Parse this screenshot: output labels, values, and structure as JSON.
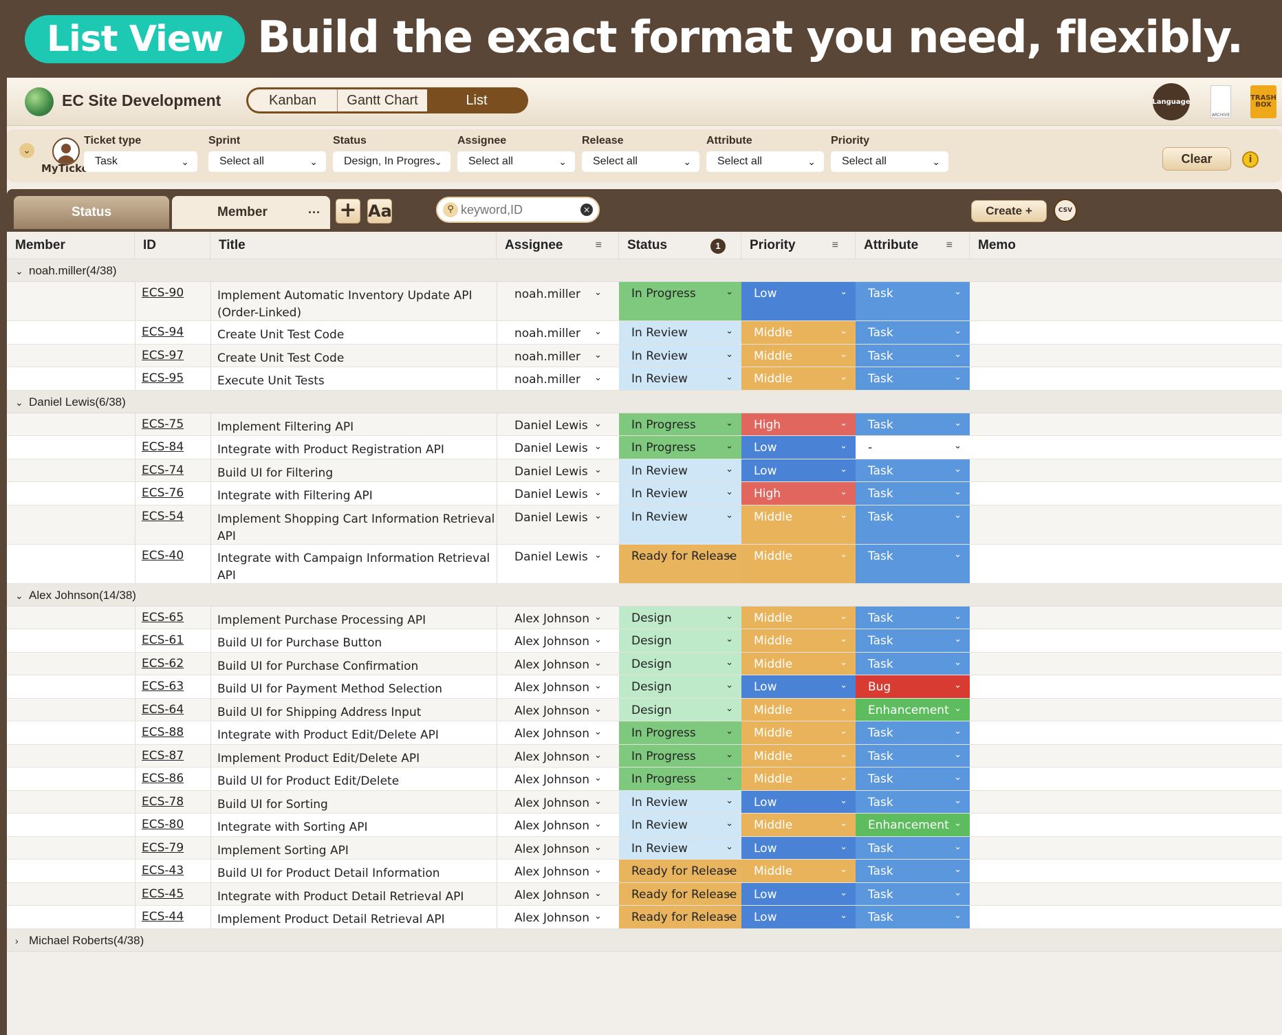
{
  "banner": {
    "pill": "List View",
    "headline": "Build the exact format you need, flexibly."
  },
  "app": {
    "title": "EC Site Development",
    "view_tabs": [
      "Kanban",
      "Gantt Chart",
      "List"
    ],
    "active_view": "List",
    "icons": {
      "language": "Language",
      "archive": "ARCHIVE",
      "trash": "TRASH BOX"
    }
  },
  "filters": {
    "myticket_label": "MyTicket",
    "items": [
      {
        "label": "Ticket type",
        "value": "Task"
      },
      {
        "label": "Sprint",
        "value": "Select all"
      },
      {
        "label": "Status",
        "value": "Design, In Progres"
      },
      {
        "label": "Assignee",
        "value": "Select all"
      },
      {
        "label": "Release",
        "value": "Select all"
      },
      {
        "label": "Attribute",
        "value": "Select all"
      },
      {
        "label": "Priority",
        "value": "Select all"
      }
    ],
    "clear_label": "Clear"
  },
  "toolbar": {
    "tab_status": "Status",
    "tab_member": "Member",
    "plus": "+",
    "font": "Aa",
    "search_placeholder": "keyword,ID",
    "create_label": "Create +",
    "csv": "CSV"
  },
  "columns": {
    "member": "Member",
    "id": "ID",
    "title": "Title",
    "assignee": "Assignee",
    "status": "Status",
    "priority": "Priority",
    "attribute": "Attribute",
    "memo": "Memo",
    "status_badge": "1"
  },
  "colors": {
    "In Progress": "#7fc97f",
    "In Review": "#cfe6f7",
    "Design": "#bfeac9",
    "Ready for Release": "#e9b45e",
    "Low": "#4a82d6",
    "Middle": "#e9b35c",
    "High": "#e0665e",
    "Task": "#5b97dc",
    "Bug": "#d83b32",
    "Enhancement": "#5dbc5d",
    "-": "#ffffff"
  },
  "groups": [
    {
      "label": "noah.miller(4/38)",
      "expanded": true,
      "rows": [
        {
          "id": "ECS-90",
          "title": "Implement Automatic Inventory Update API (Order-Linked)",
          "assignee": "noah.miller",
          "status": "In Progress",
          "priority": "Low",
          "attribute": "Task"
        },
        {
          "id": "ECS-94",
          "title": "Create Unit Test Code",
          "assignee": "noah.miller",
          "status": "In Review",
          "priority": "Middle",
          "attribute": "Task"
        },
        {
          "id": "ECS-97",
          "title": "Create Unit Test Code",
          "assignee": "noah.miller",
          "status": "In Review",
          "priority": "Middle",
          "attribute": "Task"
        },
        {
          "id": "ECS-95",
          "title": "Execute Unit Tests",
          "assignee": "noah.miller",
          "status": "In Review",
          "priority": "Middle",
          "attribute": "Task"
        }
      ]
    },
    {
      "label": "Daniel Lewis(6/38)",
      "expanded": true,
      "rows": [
        {
          "id": "ECS-75",
          "title": "Implement Filtering API",
          "assignee": "Daniel Lewis",
          "status": "In Progress",
          "priority": "High",
          "attribute": "Task"
        },
        {
          "id": "ECS-84",
          "title": "Integrate with Product Registration API",
          "assignee": "Daniel Lewis",
          "status": "In Progress",
          "priority": "Low",
          "attribute": "-"
        },
        {
          "id": "ECS-74",
          "title": "Build UI for Filtering",
          "assignee": "Daniel Lewis",
          "status": "In Review",
          "priority": "Low",
          "attribute": "Task"
        },
        {
          "id": "ECS-76",
          "title": "Integrate with Filtering API",
          "assignee": "Daniel Lewis",
          "status": "In Review",
          "priority": "High",
          "attribute": "Task"
        },
        {
          "id": "ECS-54",
          "title": "Implement Shopping Cart Information Retrieval API",
          "assignee": "Daniel Lewis",
          "status": "In Review",
          "priority": "Middle",
          "attribute": "Task"
        },
        {
          "id": "ECS-40",
          "title": "Integrate with Campaign Information Retrieval API",
          "assignee": "Daniel Lewis",
          "status": "Ready for Release",
          "priority": "Middle",
          "attribute": "Task"
        }
      ]
    },
    {
      "label": "Alex Johnson(14/38)",
      "expanded": true,
      "rows": [
        {
          "id": "ECS-65",
          "title": "Implement Purchase Processing API",
          "assignee": "Alex Johnson",
          "status": "Design",
          "priority": "Middle",
          "attribute": "Task"
        },
        {
          "id": "ECS-61",
          "title": "Build UI for Purchase Button",
          "assignee": "Alex Johnson",
          "status": "Design",
          "priority": "Middle",
          "attribute": "Task"
        },
        {
          "id": "ECS-62",
          "title": "Build UI for Purchase Confirmation",
          "assignee": "Alex Johnson",
          "status": "Design",
          "priority": "Middle",
          "attribute": "Task"
        },
        {
          "id": "ECS-63",
          "title": "Build UI for Payment Method Selection",
          "assignee": "Alex Johnson",
          "status": "Design",
          "priority": "Low",
          "attribute": "Bug"
        },
        {
          "id": "ECS-64",
          "title": "Build UI for Shipping Address Input",
          "assignee": "Alex Johnson",
          "status": "Design",
          "priority": "Middle",
          "attribute": "Enhancement"
        },
        {
          "id": "ECS-88",
          "title": "Integrate with Product Edit/Delete API",
          "assignee": "Alex Johnson",
          "status": "In Progress",
          "priority": "Middle",
          "attribute": "Task"
        },
        {
          "id": "ECS-87",
          "title": "Implement Product Edit/Delete API",
          "assignee": "Alex Johnson",
          "status": "In Progress",
          "priority": "Middle",
          "attribute": "Task"
        },
        {
          "id": "ECS-86",
          "title": "Build UI for Product Edit/Delete",
          "assignee": "Alex Johnson",
          "status": "In Progress",
          "priority": "Middle",
          "attribute": "Task"
        },
        {
          "id": "ECS-78",
          "title": "Build UI for Sorting",
          "assignee": "Alex Johnson",
          "status": "In Review",
          "priority": "Low",
          "attribute": "Task"
        },
        {
          "id": "ECS-80",
          "title": "Integrate with Sorting API",
          "assignee": "Alex Johnson",
          "status": "In Review",
          "priority": "Middle",
          "attribute": "Enhancement"
        },
        {
          "id": "ECS-79",
          "title": "Implement Sorting API",
          "assignee": "Alex Johnson",
          "status": "In Review",
          "priority": "Low",
          "attribute": "Task"
        },
        {
          "id": "ECS-43",
          "title": "Build UI for Product Detail Information",
          "assignee": "Alex Johnson",
          "status": "Ready for Release",
          "priority": "Middle",
          "attribute": "Task"
        },
        {
          "id": "ECS-45",
          "title": "Integrate with Product Detail Retrieval API",
          "assignee": "Alex Johnson",
          "status": "Ready for Release",
          "priority": "Low",
          "attribute": "Task"
        },
        {
          "id": "ECS-44",
          "title": "Implement Product Detail Retrieval API",
          "assignee": "Alex Johnson",
          "status": "Ready for Release",
          "priority": "Low",
          "attribute": "Task"
        }
      ]
    },
    {
      "label": "Michael Roberts(4/38)",
      "expanded": false,
      "rows": []
    }
  ]
}
